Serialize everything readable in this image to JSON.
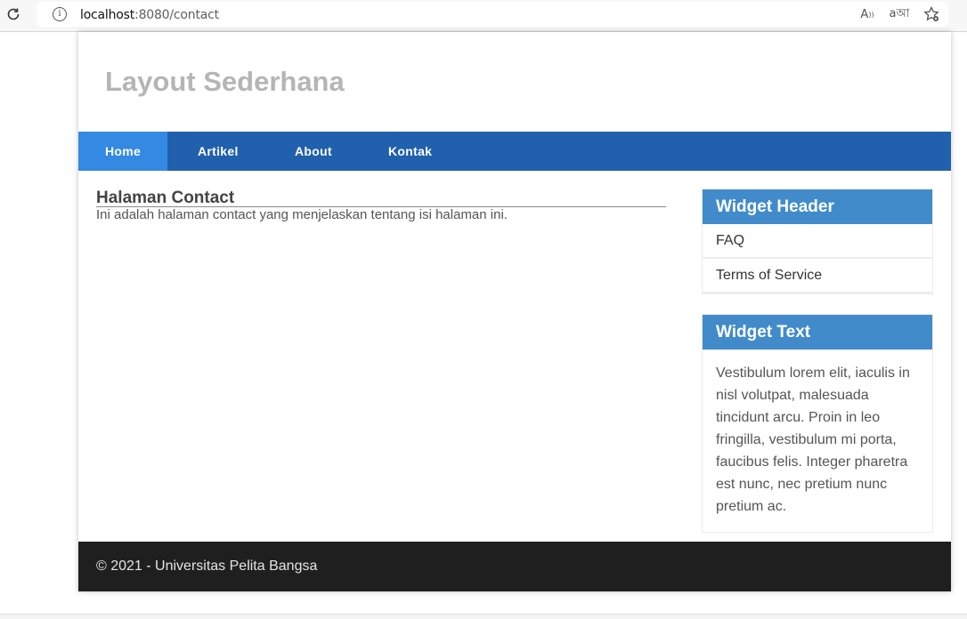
{
  "browser": {
    "url_host": "localhost",
    "url_path": ":8080/contact",
    "icons": [
      "reload-icon",
      "info-icon",
      "read-aloud-icon",
      "translate-icon",
      "favorite-icon"
    ]
  },
  "site": {
    "title": "Layout Sederhana"
  },
  "nav": {
    "items": [
      {
        "label": "Home",
        "active": true
      },
      {
        "label": "Artikel",
        "active": false
      },
      {
        "label": "About",
        "active": false
      },
      {
        "label": "Kontak",
        "active": false
      }
    ]
  },
  "main": {
    "title": "Halaman Contact",
    "text": "Ini adalah halaman contact yang menjelaskan tentang isi halaman ini."
  },
  "sidebar": {
    "widget1": {
      "header": "Widget Header",
      "items": [
        "FAQ",
        "Terms of Service"
      ]
    },
    "widget2": {
      "header": "Widget Text",
      "body": "Vestibulum lorem elit, iaculis in nisl volutpat, malesuada tincidunt arcu. Proin in leo fringilla, vestibulum mi porta, faucibus felis. Integer pharetra est nunc, nec pretium nunc pretium ac."
    }
  },
  "footer": {
    "text": "© 2021 - Universitas Pelita Bangsa"
  },
  "colors": {
    "nav_bg": "#2160ad",
    "nav_active": "#3489e2",
    "widget_header": "#428bca",
    "footer_bg": "#1f1f1f"
  }
}
